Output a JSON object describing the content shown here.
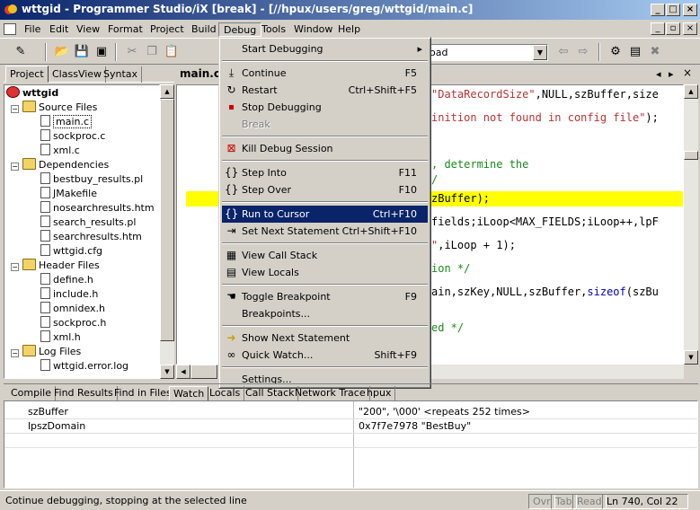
{
  "window": {
    "title": "wttgid - Programmer Studio/iX [break] - [//hpux/users/greg/wttgid/main.c]",
    "minimize": "_",
    "maximize": "□",
    "close": "×"
  },
  "menubar": {
    "items": [
      "File",
      "Edit",
      "View",
      "Format",
      "Project",
      "Build",
      "Debug",
      "Tools",
      "Window",
      "Help"
    ],
    "active": "Debug",
    "mdi_min": "_",
    "mdi_restore": "▫",
    "mdi_close": "×"
  },
  "toolbar": {
    "combo_value": "oad"
  },
  "left_panel": {
    "tabs": [
      "Project",
      "ClassView",
      "Syntax"
    ],
    "selected_tab": "Project",
    "tree": {
      "root": "wttgid",
      "groups": [
        {
          "name": "Source Files",
          "files": [
            "main.c",
            "sockproc.c",
            "xml.c"
          ]
        },
        {
          "name": "Dependencies",
          "files": [
            "bestbuy_results.pl",
            "JMakefile",
            "nosearchresults.htm",
            "search_results.pl",
            "searchresults.htm",
            "wttgid.cfg"
          ]
        },
        {
          "name": "Header Files",
          "files": [
            "define.h",
            "include.h",
            "omnidex.h",
            "sockproc.h",
            "xml.h"
          ]
        },
        {
          "name": "Log Files",
          "files": [
            "wttgid.error.log"
          ]
        }
      ]
    }
  },
  "editor": {
    "tab": "main.c",
    "tab_prev_arrow": "◂",
    "tab_next_arrow": "▸",
    "tab_close": "×",
    "lines": [
      {
        "pre": "",
        "str": "\"DataRecordSize\"",
        "post": ",NULL,szBuffer,size"
      },
      {
        "pre": "",
        "str": "inition not found in config file\"",
        "post": ");"
      },
      {
        "pre": "",
        "cmt": ", determine the",
        "post": ""
      },
      {
        "pre": "",
        "cmt": "/",
        "post": ""
      },
      {
        "pre": "zBuffer);",
        "post": ""
      },
      {
        "pre": "fields;iLoop<MAX_FIELDS;iLoop++,lpF",
        "post": ""
      },
      {
        "pre": "",
        "str": "\"",
        "post": ",iLoop + 1);"
      },
      {
        "pre": "",
        "cmt": "ion */",
        "post": ""
      },
      {
        "pre": "ain,szKey,NULL,szBuffer,",
        "kw": "sizeof",
        "post": "(szBu"
      },
      {
        "pre": "",
        "cmt": "ed */",
        "post": ""
      }
    ]
  },
  "debug_menu": {
    "items": [
      {
        "label": "Start Debugging",
        "shortcut": "",
        "submenu_arrow": "▸",
        "icon": "none"
      },
      {
        "sep": true
      },
      {
        "label": "Continue",
        "shortcut": "F5",
        "icon": "continue-icon"
      },
      {
        "label": "Restart",
        "shortcut": "Ctrl+Shift+F5",
        "icon": "restart-icon"
      },
      {
        "label": "Stop Debugging",
        "shortcut": "",
        "icon": "stop-icon"
      },
      {
        "label": "Break",
        "shortcut": "",
        "icon": "none",
        "disabled": true
      },
      {
        "sep": true
      },
      {
        "label": "Kill Debug Session",
        "shortcut": "",
        "icon": "kill-icon"
      },
      {
        "sep": true
      },
      {
        "label": "Step Into",
        "shortcut": "F11",
        "icon": "step-into-icon"
      },
      {
        "label": "Step Over",
        "shortcut": "F10",
        "icon": "step-over-icon"
      },
      {
        "sep": true
      },
      {
        "label": "Run to Cursor",
        "shortcut": "Ctrl+F10",
        "icon": "run-to-cursor-icon",
        "highlighted": true
      },
      {
        "label": "Set Next Statement",
        "shortcut": "Ctrl+Shift+F10",
        "icon": "set-next-icon"
      },
      {
        "sep": true
      },
      {
        "label": "View Call Stack",
        "shortcut": "",
        "icon": "call-stack-icon"
      },
      {
        "label": "View Locals",
        "shortcut": "",
        "icon": "locals-icon"
      },
      {
        "sep": true
      },
      {
        "label": "Toggle Breakpoint",
        "shortcut": "F9",
        "icon": "hand-icon"
      },
      {
        "label": "Breakpoints...",
        "shortcut": "",
        "icon": "none"
      },
      {
        "sep": true
      },
      {
        "label": "Show Next Statement",
        "shortcut": "",
        "icon": "arrow-icon"
      },
      {
        "label": "Quick Watch...",
        "shortcut": "Shift+F9",
        "icon": "glasses-icon"
      },
      {
        "sep": true
      },
      {
        "label": "Settings...",
        "shortcut": "",
        "icon": "none"
      }
    ]
  },
  "bottom_tabs": {
    "items": [
      "Compile",
      "Find Results",
      "Find in Files",
      "Watch",
      "Locals",
      "Call Stack",
      "Network Trace",
      "hpux"
    ],
    "selected": "Watch"
  },
  "watch": {
    "rows": [
      {
        "name": "szBuffer",
        "value": "\"200\", '\\000' <repeats 252 times>"
      },
      {
        "name": "lpszDomain",
        "value": "0x7f7e7978 \"BestBuy\""
      }
    ]
  },
  "statusbar": {
    "message": "Cotinue debugging, stopping at the selected line",
    "ovr": "Ovr",
    "tab": "Tab",
    "read": "Read",
    "position": "Ln 740, Col 22"
  }
}
